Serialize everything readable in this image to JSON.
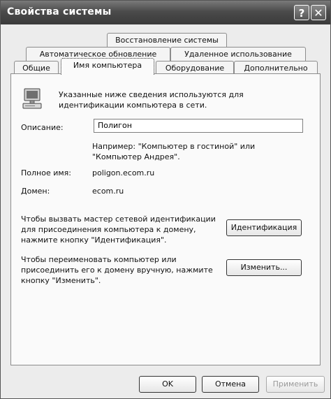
{
  "window": {
    "title": "Свойства системы",
    "help_glyph": "?",
    "close_glyph": "✕"
  },
  "tabs": {
    "row1": [
      "Восстановление системы"
    ],
    "row2": [
      "Автоматическое обновление",
      "Удаленное использование"
    ],
    "row3": [
      "Общие",
      "Имя компьютера",
      "Оборудование",
      "Дополнительно"
    ],
    "active": "Имя компьютера"
  },
  "panel": {
    "intro": [
      "Указанные ниже сведения используются для",
      "идентификации компьютера в сети."
    ],
    "description_label": "Описание:",
    "description_value": "Полигон",
    "example": [
      "Например: \"Компьютер в гостиной\" или",
      "\"Компьютер Андрея\"."
    ],
    "fullname_label": "Полное имя:",
    "fullname_value": "poligon.ecom.ru",
    "domain_label": "Домен:",
    "domain_value": "ecom.ru",
    "wizard_text": [
      "Чтобы вызвать мастер сетевой идентификации",
      "для присоединения компьютера к домену,",
      "нажмите кнопку \"Идентификация\"."
    ],
    "wizard_button": "Идентификация",
    "rename_text": [
      "Чтобы переименовать компьютер или",
      "присоединить его к домену вручную, нажмите",
      "кнопку \"Изменить\"."
    ],
    "rename_button": "Изменить..."
  },
  "footer": {
    "ok": "OK",
    "cancel": "Отмена",
    "apply": "Применить"
  }
}
